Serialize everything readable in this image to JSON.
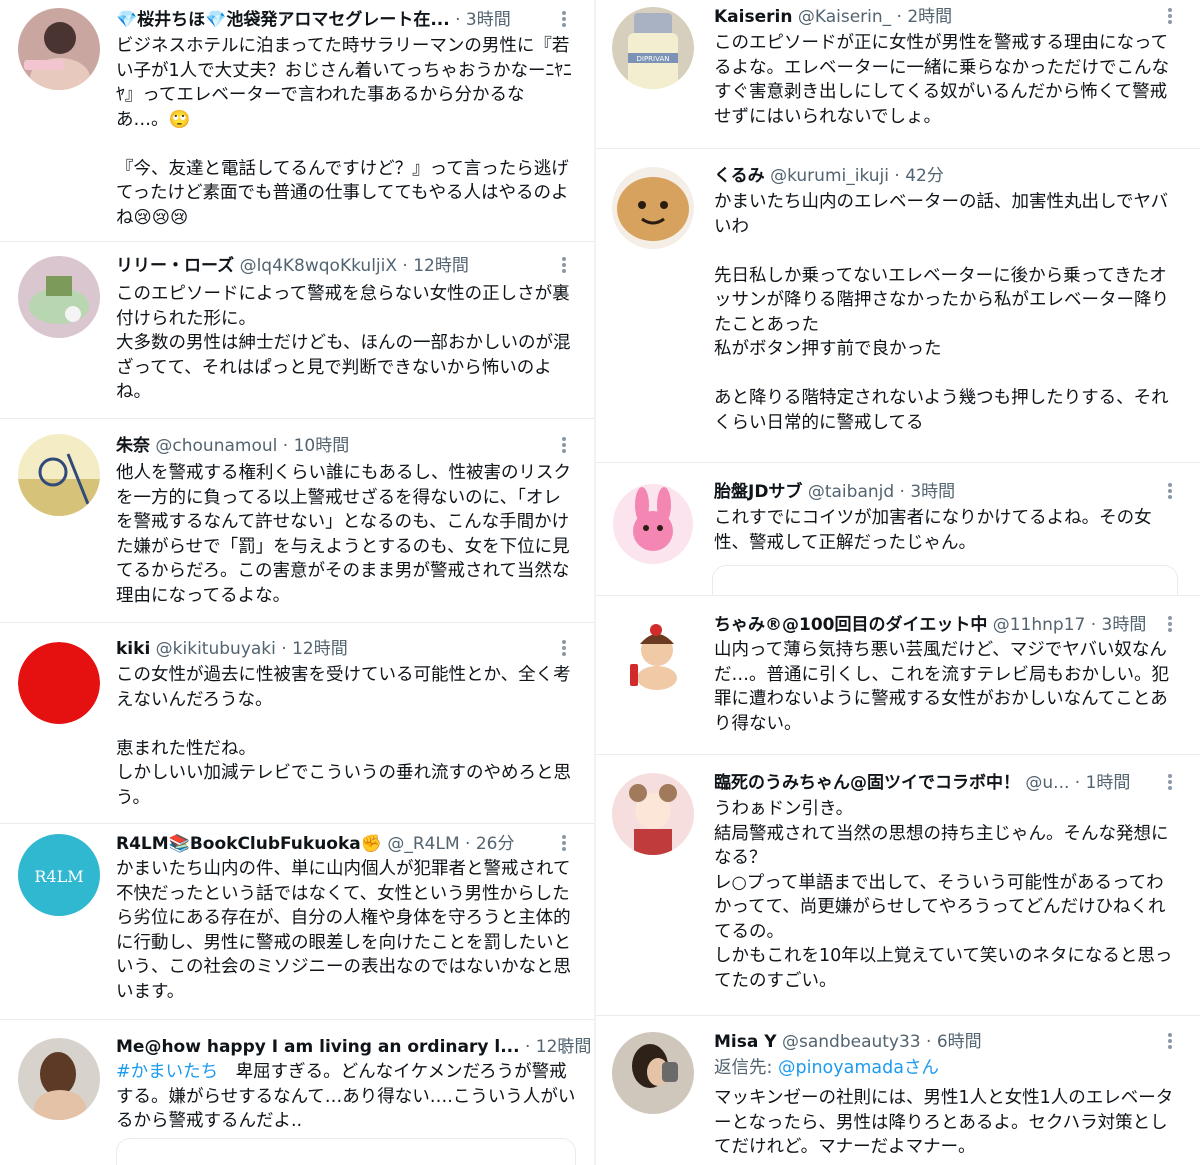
{
  "left": {
    "tweets": [
      {
        "name": "💎桜井ちほ💎池袋発アロマセグレート在...",
        "meta": "· 3時間",
        "body": "ビジネスホテルに泊まってた時サラリーマンの男性に『若い子が1人で大丈夫？おじさん着いてっちゃおうかなーﾆﾔﾆﾔ』ってエレベーターで言われた事あるから分かるなあ…。🙄\n\n『今、友達と電話してるんですけど？』って言ったら逃げてったけど素面でも普通の仕事しててもやる人はやるのよね😢😢😢"
      },
      {
        "name": "リリー・ローズ",
        "meta": "@lq4K8wqoKkuljiX · 12時間",
        "body": "このエピソードによって警戒を怠らない女性の正しさが裏付けられた形に。\n大多数の男性は紳士だけども、ほんの一部おかしいのが混ざってて、それはぱっと見で判断できないから怖いのよね。"
      },
      {
        "name": "朱奈",
        "meta": "@chounamoul · 10時間",
        "body": "他人を警戒する権利くらい誰にもあるし、性被害のリスクを一方的に負ってる以上警戒せざるを得ないのに、「オレを警戒するなんて許せない」となるのも、こんな手間かけた嫌がらせで「罰」を与えようとするのも、女を下位に見てるからだろ。この害意がそのまま男が警戒されて当然な理由になってるよな。"
      },
      {
        "name": "kiki",
        "meta": "@kikitubuyaki · 12時間",
        "body": "この女性が過去に性被害を受けている可能性とか、全く考えないんだろうな。\n\n恵まれた性だね。\nしかしいい加減テレビでこういうの垂れ流すのやめろと思う。"
      },
      {
        "name": "R4LM📚BookClubFukuoka✊",
        "meta": "@_R4LM · 26分",
        "body": "かまいたち山内の件、単に山内個人が犯罪者と警戒されて不快だったという話ではなくて、女性という男性からしたら劣位にある存在が、自分の人権や身体を守ろうと主体的に行動し、男性に警戒の眼差しを向けたことを罰したいという、この社会のミソジニーの表出なのではないかなと思います。"
      },
      {
        "name": "Me@how happy I am living an ordinary l...",
        "meta": "· 12時間",
        "hashtag": "#かまいたち",
        "body": "　卑屈すぎる。どんなイケメンだろうが警戒する。嫌がらせするなんて…あり得ない….こういう人がいるから警戒するんだよ.."
      }
    ]
  },
  "right": {
    "tweets": [
      {
        "name": "Kaiserin",
        "meta": "@Kaiserin_ · 2時間",
        "body": "このエピソードが正に女性が男性を警戒する理由になってるよな。エレベーターに一緒に乗らなかっただけでこんなすぐ害意剥き出しにしてくる奴がいるんだから怖くて警戒せずにはいられないでしょ。"
      },
      {
        "name": "くるみ",
        "meta": "@kurumi_ikuji · 42分",
        "body": "かまいたち山内のエレベーターの話、加害性丸出しでヤバいわ\n\n先日私しか乗ってないエレベーターに後から乗ってきたオッサンが降りる階押さなかったから私がエレベーター降りたことあった\n私がボタン押す前で良かった\n\nあと降りる階特定されないよう幾つも押したりする、それくらい日常的に警戒してる"
      },
      {
        "name": "胎盤JDサブ",
        "meta": "@taibanjd · 3時間",
        "body": "これすでにコイツが加害者になりかけてるよね。その女性、警戒して正解だったじゃん。"
      },
      {
        "name": "ちゃみ®@100回目のダイエット中",
        "meta": "@11hnp17 · 3時間",
        "body": "山内って薄ら気持ち悪い芸風だけど、マジでヤバい奴なんだ…。普通に引くし、これを流すテレビ局もおかしい。犯罪に遭わないように警戒する女性がおかしいなんてことあり得ない。"
      },
      {
        "name": "臨死のうみちゃん@固ツイでコラボ中！",
        "meta": "@u... · 1時間",
        "body": "うわぁドン引き。\n結局警戒されて当然の思想の持ち主じゃん。そんな発想になる？\nレ○プって単語まで出して、そういう可能性があるってわかってて、尚更嫌がらせしてやろうってどんだけひねくれてるの。\nしかもこれを10年以上覚えていて笑いのネタになると思ってたのすごい。"
      },
      {
        "name": "Misa Y",
        "meta": "@sandbeauty33 · 6時間",
        "reply_prefix": "返信先: ",
        "reply_handle": "@pinoyamadaさん",
        "body": "マッキンゼーの社則には、男性1人と女性1人のエレベーターとなったら、男性は降りろとあるよ。セクハラ対策としてだけれど。マナーだよマナー。"
      }
    ]
  }
}
